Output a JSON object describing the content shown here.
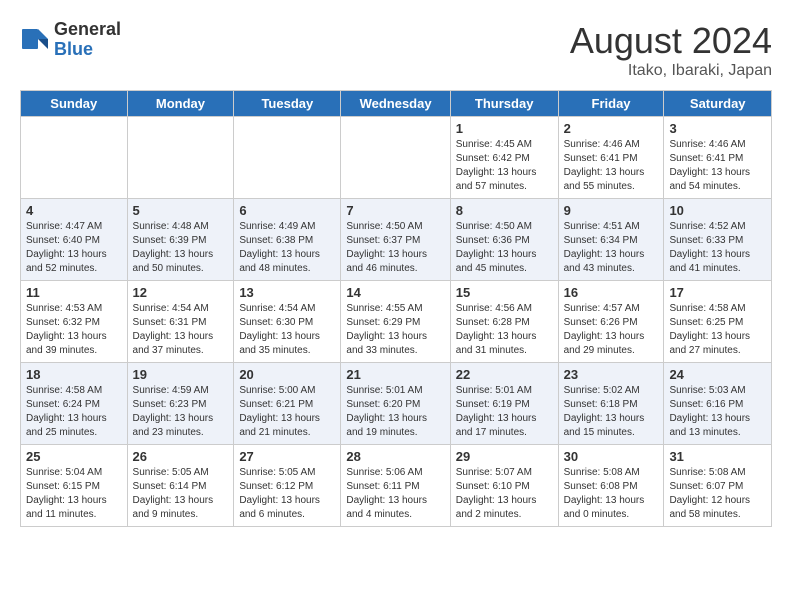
{
  "logo": {
    "general": "General",
    "blue": "Blue"
  },
  "title": "August 2024",
  "location": "Itako, Ibaraki, Japan",
  "days_of_week": [
    "Sunday",
    "Monday",
    "Tuesday",
    "Wednesday",
    "Thursday",
    "Friday",
    "Saturday"
  ],
  "weeks": [
    [
      {
        "day": "",
        "info": ""
      },
      {
        "day": "",
        "info": ""
      },
      {
        "day": "",
        "info": ""
      },
      {
        "day": "",
        "info": ""
      },
      {
        "day": "1",
        "info": "Sunrise: 4:45 AM\nSunset: 6:42 PM\nDaylight: 13 hours and 57 minutes."
      },
      {
        "day": "2",
        "info": "Sunrise: 4:46 AM\nSunset: 6:41 PM\nDaylight: 13 hours and 55 minutes."
      },
      {
        "day": "3",
        "info": "Sunrise: 4:46 AM\nSunset: 6:41 PM\nDaylight: 13 hours and 54 minutes."
      }
    ],
    [
      {
        "day": "4",
        "info": "Sunrise: 4:47 AM\nSunset: 6:40 PM\nDaylight: 13 hours and 52 minutes."
      },
      {
        "day": "5",
        "info": "Sunrise: 4:48 AM\nSunset: 6:39 PM\nDaylight: 13 hours and 50 minutes."
      },
      {
        "day": "6",
        "info": "Sunrise: 4:49 AM\nSunset: 6:38 PM\nDaylight: 13 hours and 48 minutes."
      },
      {
        "day": "7",
        "info": "Sunrise: 4:50 AM\nSunset: 6:37 PM\nDaylight: 13 hours and 46 minutes."
      },
      {
        "day": "8",
        "info": "Sunrise: 4:50 AM\nSunset: 6:36 PM\nDaylight: 13 hours and 45 minutes."
      },
      {
        "day": "9",
        "info": "Sunrise: 4:51 AM\nSunset: 6:34 PM\nDaylight: 13 hours and 43 minutes."
      },
      {
        "day": "10",
        "info": "Sunrise: 4:52 AM\nSunset: 6:33 PM\nDaylight: 13 hours and 41 minutes."
      }
    ],
    [
      {
        "day": "11",
        "info": "Sunrise: 4:53 AM\nSunset: 6:32 PM\nDaylight: 13 hours and 39 minutes."
      },
      {
        "day": "12",
        "info": "Sunrise: 4:54 AM\nSunset: 6:31 PM\nDaylight: 13 hours and 37 minutes."
      },
      {
        "day": "13",
        "info": "Sunrise: 4:54 AM\nSunset: 6:30 PM\nDaylight: 13 hours and 35 minutes."
      },
      {
        "day": "14",
        "info": "Sunrise: 4:55 AM\nSunset: 6:29 PM\nDaylight: 13 hours and 33 minutes."
      },
      {
        "day": "15",
        "info": "Sunrise: 4:56 AM\nSunset: 6:28 PM\nDaylight: 13 hours and 31 minutes."
      },
      {
        "day": "16",
        "info": "Sunrise: 4:57 AM\nSunset: 6:26 PM\nDaylight: 13 hours and 29 minutes."
      },
      {
        "day": "17",
        "info": "Sunrise: 4:58 AM\nSunset: 6:25 PM\nDaylight: 13 hours and 27 minutes."
      }
    ],
    [
      {
        "day": "18",
        "info": "Sunrise: 4:58 AM\nSunset: 6:24 PM\nDaylight: 13 hours and 25 minutes."
      },
      {
        "day": "19",
        "info": "Sunrise: 4:59 AM\nSunset: 6:23 PM\nDaylight: 13 hours and 23 minutes."
      },
      {
        "day": "20",
        "info": "Sunrise: 5:00 AM\nSunset: 6:21 PM\nDaylight: 13 hours and 21 minutes."
      },
      {
        "day": "21",
        "info": "Sunrise: 5:01 AM\nSunset: 6:20 PM\nDaylight: 13 hours and 19 minutes."
      },
      {
        "day": "22",
        "info": "Sunrise: 5:01 AM\nSunset: 6:19 PM\nDaylight: 13 hours and 17 minutes."
      },
      {
        "day": "23",
        "info": "Sunrise: 5:02 AM\nSunset: 6:18 PM\nDaylight: 13 hours and 15 minutes."
      },
      {
        "day": "24",
        "info": "Sunrise: 5:03 AM\nSunset: 6:16 PM\nDaylight: 13 hours and 13 minutes."
      }
    ],
    [
      {
        "day": "25",
        "info": "Sunrise: 5:04 AM\nSunset: 6:15 PM\nDaylight: 13 hours and 11 minutes."
      },
      {
        "day": "26",
        "info": "Sunrise: 5:05 AM\nSunset: 6:14 PM\nDaylight: 13 hours and 9 minutes."
      },
      {
        "day": "27",
        "info": "Sunrise: 5:05 AM\nSunset: 6:12 PM\nDaylight: 13 hours and 6 minutes."
      },
      {
        "day": "28",
        "info": "Sunrise: 5:06 AM\nSunset: 6:11 PM\nDaylight: 13 hours and 4 minutes."
      },
      {
        "day": "29",
        "info": "Sunrise: 5:07 AM\nSunset: 6:10 PM\nDaylight: 13 hours and 2 minutes."
      },
      {
        "day": "30",
        "info": "Sunrise: 5:08 AM\nSunset: 6:08 PM\nDaylight: 13 hours and 0 minutes."
      },
      {
        "day": "31",
        "info": "Sunrise: 5:08 AM\nSunset: 6:07 PM\nDaylight: 12 hours and 58 minutes."
      }
    ]
  ]
}
